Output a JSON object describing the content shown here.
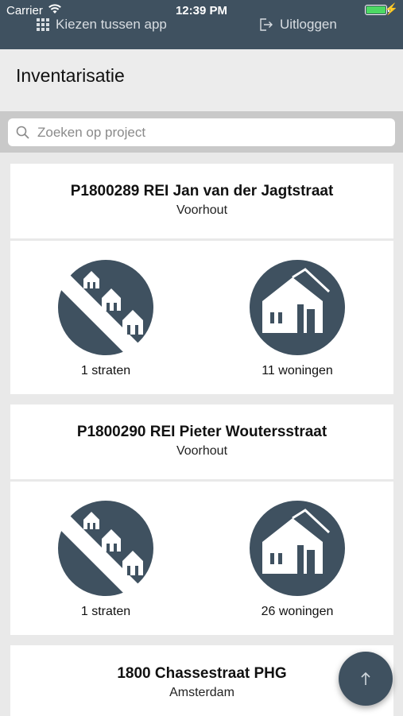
{
  "status_bar": {
    "carrier": "Carrier",
    "time": "12:39 PM",
    "battery_level": 1.0,
    "battery_color": "#4cd964"
  },
  "top_nav": {
    "switch_app_label": "Kiezen tussen app",
    "switch_app_icon": "grid-icon",
    "logout_label": "Uitloggen",
    "logout_icon": "logout-icon"
  },
  "header": {
    "title": "Inventarisatie"
  },
  "search": {
    "placeholder": "Zoeken op project",
    "value": ""
  },
  "projects": [
    {
      "name": "P1800289 REI Jan van der Jagtstraat",
      "place": "Voorhout",
      "streets_label": "1 straten",
      "homes_label": "11 woningen"
    },
    {
      "name": "P1800290 REI Pieter Woutersstraat",
      "place": "Voorhout",
      "streets_label": "1 straten",
      "homes_label": "26 woningen"
    },
    {
      "name": "1800 Chassestraat PHG",
      "place": "Amsterdam"
    }
  ],
  "colors": {
    "primary": "#3f5160",
    "background": "#e9e9e9"
  },
  "fab": {
    "icon": "arrow-up-icon"
  }
}
